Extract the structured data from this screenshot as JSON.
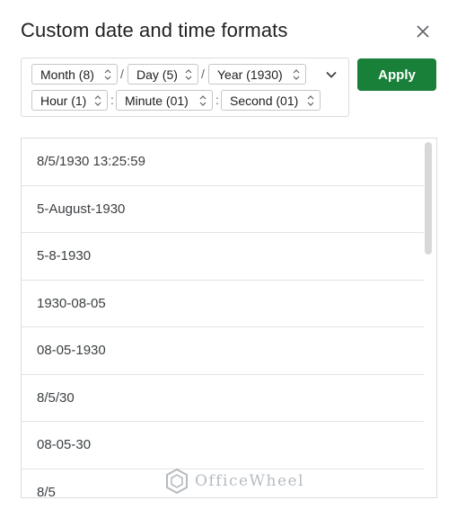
{
  "dialog": {
    "title": "Custom date and time formats",
    "close_icon": "close-icon",
    "apply_label": "Apply",
    "apply_color": "#188038",
    "expand_icon": "chevron-down-icon"
  },
  "format_row1": {
    "month": "Month (8)",
    "sep1": "/",
    "day": "Day (5)",
    "sep2": "/",
    "year": "Year (1930)"
  },
  "format_row2": {
    "hour": "Hour (1)",
    "sep1": ":",
    "minute": "Minute (01)",
    "sep2": ":",
    "second": "Second (01)"
  },
  "formats": [
    "8/5/1930 13:25:59",
    "5-August-1930",
    "5-8-1930",
    "1930-08-05",
    "08-05-1930",
    "8/5/30",
    "08-05-30",
    "8/5"
  ],
  "watermark": {
    "text": "OfficeWheel",
    "icon": "officewheel-logo-icon"
  }
}
